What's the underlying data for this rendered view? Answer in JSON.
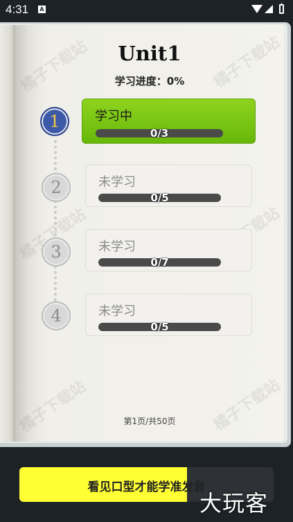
{
  "status_bar": {
    "time": "4:31",
    "notification_glyph": "A",
    "icons": [
      "wifi-icon",
      "signal-icon",
      "battery-icon"
    ]
  },
  "watermark": "橘子下载站",
  "unit": {
    "title": "Unit1",
    "progress_label": "学习进度：0%"
  },
  "lessons": [
    {
      "number": "1",
      "status": "学习中",
      "count": "0/3",
      "progress": 0,
      "active": true
    },
    {
      "number": "2",
      "status": "未学习",
      "count": "0/5",
      "progress": 0,
      "active": false
    },
    {
      "number": "3",
      "status": "未学习",
      "count": "0/7",
      "progress": 0,
      "active": false
    },
    {
      "number": "4",
      "status": "未学习",
      "count": "0/5",
      "progress": 0,
      "active": false
    }
  ],
  "page_indicator": "第1页/共50页",
  "tip": {
    "text": "看见口型才能学准发音",
    "progress": 0.66
  },
  "brand": "大玩客",
  "colors": {
    "active_card": "#7ac514",
    "active_circle": "#3d5aa8",
    "number_gold": "#f5c945",
    "tip_yellow": "#ffff33"
  }
}
